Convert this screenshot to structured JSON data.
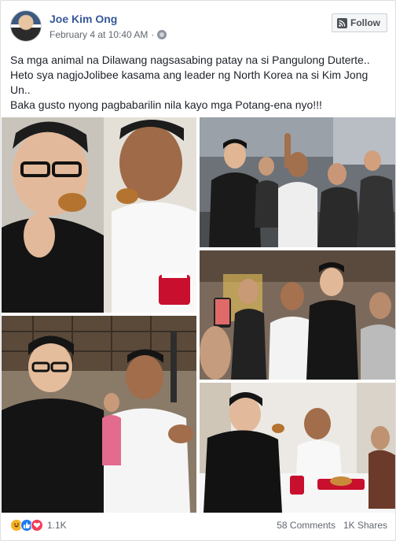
{
  "post": {
    "author": "Joe Kim Ong",
    "timestamp": "February 4 at 10:40 AM",
    "follow_label": "Follow",
    "text_lines": [
      "Sa mga animal na Dilawang nagsasabing patay na si Pangulong Duterte..",
      "Heto sya nagjoJolibee kasama ang leader ng North Korea na si Kim Jong Un..",
      "Baka gusto nyong pagbabarilin nila kayo mga Potang-ena nyo!!!"
    ]
  },
  "footer": {
    "reaction_count": "1.1K",
    "comments": "58 Comments",
    "shares": "1K Shares"
  },
  "icons": [
    "globe-icon",
    "rss-icon",
    "haha-icon",
    "like-icon",
    "love-icon"
  ]
}
